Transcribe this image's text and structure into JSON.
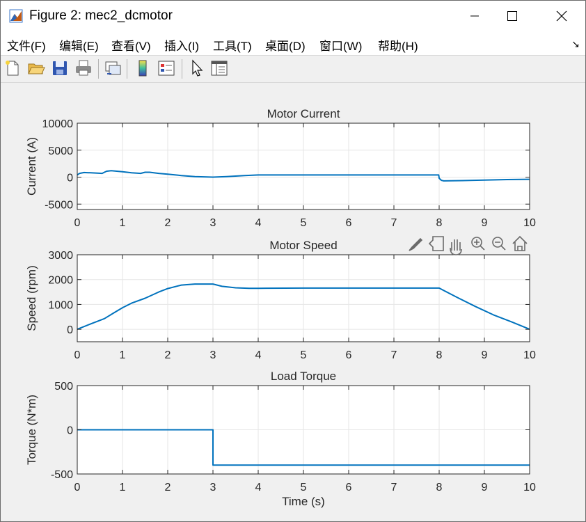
{
  "window": {
    "title": "Figure 2: mec2_dcmotor",
    "minimize_icon": "minimize-icon",
    "maximize_icon": "maximize-icon",
    "close_icon": "close-icon"
  },
  "menu": {
    "items": [
      "文件(F)",
      "编辑(E)",
      "查看(V)",
      "插入(I)",
      "工具(T)",
      "桌面(D)",
      "窗口(W)",
      "帮助(H)"
    ]
  },
  "toolbar": {
    "buttons": [
      "new-figure-icon",
      "open-file-icon",
      "save-icon",
      "print-icon",
      "link-plot-icon",
      "insert-colorbar-icon",
      "insert-legend-icon",
      "edit-plot-arrow-icon",
      "property-inspector-icon"
    ]
  },
  "axes_toolbar": {
    "buttons": [
      "brush-icon",
      "data-tips-icon",
      "pan-hand-icon",
      "zoom-in-icon",
      "zoom-out-icon",
      "restore-view-home-icon"
    ]
  },
  "colors": {
    "line": "#0072bd",
    "grid": "#e6e6e6",
    "axis": "#262626"
  },
  "chart_data": [
    {
      "type": "line",
      "title": "Motor Current",
      "xlabel": "",
      "ylabel": "Current (A)",
      "xlim": [
        0,
        10
      ],
      "ylim": [
        -6000,
        10000
      ],
      "xticks": [
        0,
        1,
        2,
        3,
        4,
        5,
        6,
        7,
        8,
        9,
        10
      ],
      "yticks": [
        -5000,
        0,
        5000,
        10000
      ],
      "grid": true,
      "series": [
        {
          "x": [
            0,
            0.05,
            0.15,
            0.3,
            0.55,
            0.6,
            0.65,
            0.75,
            1.0,
            1.2,
            1.4,
            1.5,
            1.6,
            1.8,
            2.0,
            2.3,
            2.6,
            3.0,
            3.3,
            3.7,
            4.0,
            5.0,
            6.0,
            7.0,
            7.99,
            8.0,
            8.05,
            8.1,
            8.5,
            9.0,
            9.5,
            10.0
          ],
          "y": [
            400,
            700,
            850,
            800,
            700,
            900,
            1100,
            1200,
            1000,
            800,
            700,
            900,
            900,
            700,
            550,
            300,
            100,
            0,
            100,
            300,
            400,
            400,
            400,
            400,
            400,
            -200,
            -600,
            -700,
            -650,
            -550,
            -450,
            -400
          ]
        }
      ]
    },
    {
      "type": "line",
      "title": "Motor Speed",
      "xlabel": "",
      "ylabel": "Speed (rpm)",
      "xlim": [
        0,
        10
      ],
      "ylim": [
        -500,
        3000
      ],
      "xticks": [
        0,
        1,
        2,
        3,
        4,
        5,
        6,
        7,
        8,
        9,
        10
      ],
      "yticks": [
        0,
        1000,
        2000,
        3000
      ],
      "grid": true,
      "series": [
        {
          "x": [
            0,
            0.3,
            0.6,
            0.8,
            1.0,
            1.2,
            1.5,
            1.8,
            2.0,
            2.3,
            2.6,
            3.0,
            3.2,
            3.5,
            3.8,
            4.0,
            5.0,
            6.0,
            7.0,
            8.0,
            8.4,
            8.8,
            9.2,
            9.6,
            10.0
          ],
          "y": [
            0,
            220,
            430,
            650,
            870,
            1050,
            1250,
            1500,
            1640,
            1780,
            1820,
            1820,
            1730,
            1670,
            1650,
            1650,
            1660,
            1660,
            1660,
            1660,
            1280,
            920,
            580,
            300,
            0
          ]
        }
      ]
    },
    {
      "type": "line",
      "title": "Load Torque",
      "xlabel": "Time (s)",
      "ylabel": "Torque (N*m)",
      "xlim": [
        0,
        10
      ],
      "ylim": [
        -500,
        500
      ],
      "xticks": [
        0,
        1,
        2,
        3,
        4,
        5,
        6,
        7,
        8,
        9,
        10
      ],
      "yticks": [
        -500,
        0,
        500
      ],
      "grid": true,
      "series": [
        {
          "x": [
            0,
            3.0,
            3.0,
            10.0
          ],
          "y": [
            0,
            0,
            -400,
            -400
          ]
        }
      ]
    }
  ]
}
